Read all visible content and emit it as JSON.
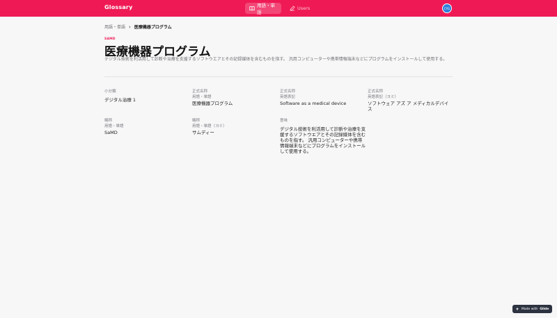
{
  "app": {
    "title": "Glossary"
  },
  "nav": {
    "items": [
      {
        "label": "用語・単語",
        "icon": "book-icon",
        "active": true
      },
      {
        "label": "Users",
        "icon": "pen-icon",
        "active": false
      }
    ]
  },
  "user": {
    "avatar_text": "CYG"
  },
  "breadcrumb": {
    "parent": "用語・単語",
    "separator": "›",
    "current": "医療機器プログラム"
  },
  "detail": {
    "overline": "SAMD",
    "title": "医療機器プログラム",
    "description": "デジタル技術を利活用して診断や治療を支援するソフトウエアとその記録媒体を含むものを指す。 汎用コンピューターや携帯情報端末などにプログラムをインストールして使用する。",
    "fields": [
      {
        "label": "小分類",
        "sublabel": "",
        "value": "デジタル治療 1"
      },
      {
        "label": "正式名称",
        "sublabel": "用語・単語",
        "value": "医療機器プログラム"
      },
      {
        "label": "正式名称",
        "sublabel": "英語表記",
        "value": "Software as a medical device"
      },
      {
        "label": "正式名称",
        "sublabel": "英語表記（ヨミ）",
        "value": "ソフトウェア アズ ア メディカルデバイス"
      },
      {
        "label": "略称",
        "sublabel": "用語・単語",
        "value": "SaMD"
      },
      {
        "label": "略称",
        "sublabel": "用語・単語（ヨミ）",
        "value": "サムディー"
      },
      {
        "label": "意味",
        "sublabel": "",
        "value": "デジタル技術を利活用して診断や治療を支援するソフトウエアとその記録媒体を含むものを指す。 汎用コンピューターや携帯情報端末などにプログラムをインストールして使用する。"
      }
    ]
  },
  "footer": {
    "badge_prefix": "Made with",
    "badge_brand": "Glide"
  },
  "colors": {
    "accent": "#ef1a55",
    "avatar": "#2f7fd8",
    "badge_bg": "#2d3340"
  }
}
